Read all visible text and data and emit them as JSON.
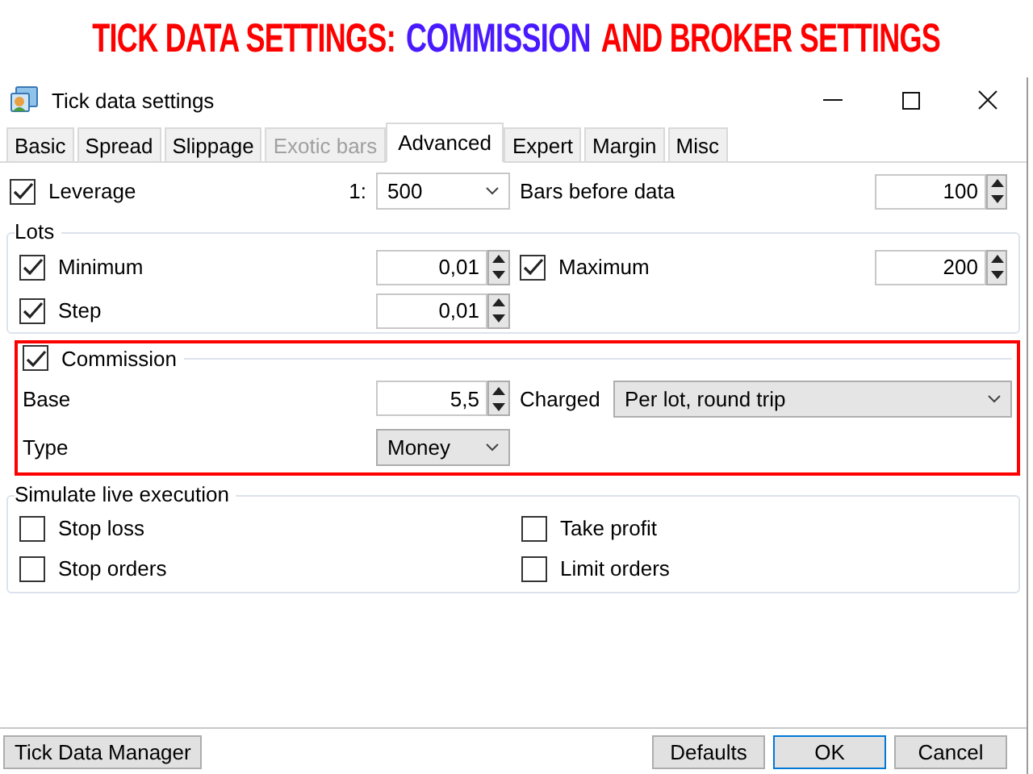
{
  "banner": {
    "segments": [
      {
        "text": "TICK DATA SETTINGS:",
        "color": "#ff0000"
      },
      {
        "text": "COMMISSION",
        "color": "#4a1aff"
      },
      {
        "text": "AND BROKER SETTINGS",
        "color": "#ff0000"
      }
    ]
  },
  "window": {
    "title": "Tick data settings"
  },
  "tabs": [
    {
      "label": "Basic",
      "selected": false,
      "disabled": false
    },
    {
      "label": "Spread",
      "selected": false,
      "disabled": false
    },
    {
      "label": "Slippage",
      "selected": false,
      "disabled": false
    },
    {
      "label": "Exotic bars",
      "selected": false,
      "disabled": true
    },
    {
      "label": "Advanced",
      "selected": true,
      "disabled": false
    },
    {
      "label": "Expert",
      "selected": false,
      "disabled": false
    },
    {
      "label": "Margin",
      "selected": false,
      "disabled": false
    },
    {
      "label": "Misc",
      "selected": false,
      "disabled": false
    }
  ],
  "leverage": {
    "label": "Leverage",
    "checked": true,
    "prefix": "1:",
    "value": "500",
    "editable": true
  },
  "bars_before_data": {
    "label": "Bars before data",
    "value": "100"
  },
  "lots": {
    "title": "Lots",
    "minimum": {
      "label": "Minimum",
      "checked": true,
      "value": "0,01"
    },
    "maximum": {
      "label": "Maximum",
      "checked": true,
      "value": "200"
    },
    "step": {
      "label": "Step",
      "checked": true,
      "value": "0,01"
    }
  },
  "commission": {
    "label": "Commission",
    "checked": true,
    "highlighted": true,
    "base": {
      "label": "Base",
      "value": "5,5"
    },
    "charged": {
      "label": "Charged",
      "value": "Per lot, round trip",
      "editable": false
    },
    "type": {
      "label": "Type",
      "value": "Money",
      "editable": false
    }
  },
  "simulate": {
    "title": "Simulate live execution",
    "options": [
      {
        "label": "Stop loss",
        "checked": false
      },
      {
        "label": "Take profit",
        "checked": false
      },
      {
        "label": "Stop orders",
        "checked": false
      },
      {
        "label": "Limit orders",
        "checked": false
      }
    ]
  },
  "footer": {
    "manager": "Tick Data Manager",
    "buttons": [
      {
        "label": "Defaults",
        "focused": false
      },
      {
        "label": "OK",
        "focused": true
      },
      {
        "label": "Cancel",
        "focused": false
      }
    ]
  }
}
